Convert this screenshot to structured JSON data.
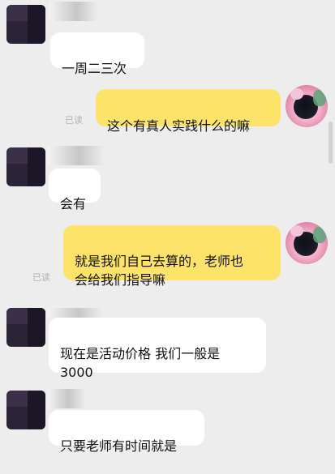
{
  "messages": [
    {
      "side": "left",
      "text": "一周二三次"
    },
    {
      "side": "right",
      "text": "这个有真人实践什么的嘛",
      "read": "已读"
    },
    {
      "side": "left",
      "text": "会有"
    },
    {
      "side": "right",
      "text": "就是我们自己去算的，老师也\n会给我们指导嘛",
      "read": "已读"
    },
    {
      "side": "left",
      "text": "现在是活动价格 我们一般是\n3000"
    },
    {
      "side": "left",
      "text": "只要老师有时间就是"
    }
  ],
  "colors": {
    "background": "#ededed",
    "incoming_bubble": "#ffffff",
    "outgoing_bubble": "#fde36a",
    "read_label": "#b3b3b3"
  },
  "icons": {
    "contact_avatar": "blurred-contact-avatar",
    "self_avatar": "anime-girl-avatar"
  }
}
